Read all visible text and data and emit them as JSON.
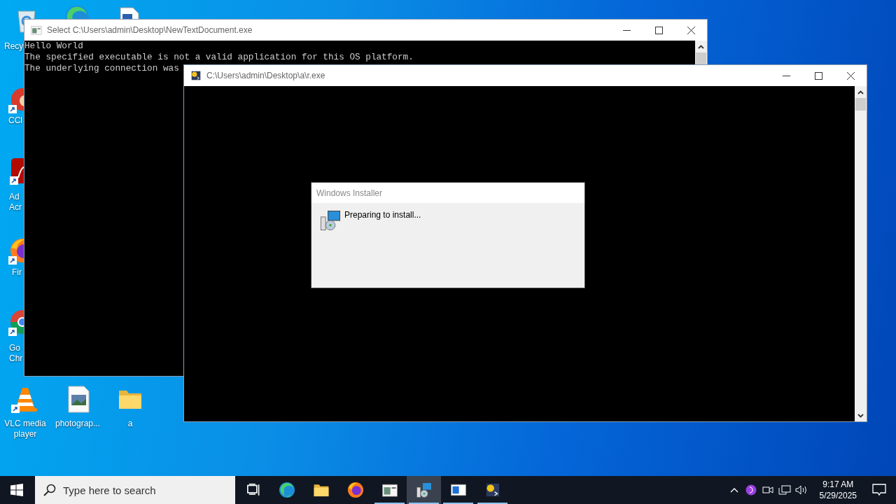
{
  "desktop_icons": [
    {
      "kind": "recycle-bin",
      "shortcut": false,
      "label": [
        "Recy"
      ]
    },
    {
      "kind": "browser",
      "shortcut": false
    },
    {
      "kind": "document",
      "shortcut": false
    },
    {
      "kind": "brush",
      "shortcut": true,
      "label": [
        "CCl"
      ]
    },
    {
      "kind": "pdf",
      "shortcut": true,
      "label": [
        "Ad",
        "Acr"
      ]
    },
    {
      "kind": "fox",
      "shortcut": true,
      "label": [
        "Fir"
      ]
    },
    {
      "kind": "chrome",
      "shortcut": true,
      "label": [
        "Go",
        "Chr"
      ]
    },
    {
      "kind": "cone",
      "shortcut": true,
      "label": [
        "VLC media",
        "player"
      ]
    },
    {
      "kind": "image-file",
      "shortcut": false,
      "label": [
        "photograp..."
      ]
    },
    {
      "kind": "folder",
      "shortcut": false,
      "label": [
        "a"
      ]
    }
  ],
  "windows": [
    {
      "title": "Select C:\\Users\\admin\\Desktop\\NewTextDocument.exe",
      "lines": [
        "Hello World",
        "The specified executable is not a valid application for this OS platform.",
        "The underlying connection was"
      ]
    },
    {
      "title": "C:\\Users\\admin\\Desktop\\a\\r.exe",
      "dialog": {
        "title": "Windows Installer",
        "message": "Preparing to install..."
      }
    }
  ],
  "taskbar": {
    "search": {
      "placeholder": "Type here to search"
    },
    "apps": [
      {
        "kind": "task-view",
        "running": false,
        "selected": false
      },
      {
        "kind": "browser",
        "running": false,
        "selected": false
      },
      {
        "kind": "folder",
        "running": false,
        "selected": false
      },
      {
        "kind": "fox",
        "running": false,
        "selected": false
      },
      {
        "kind": "console",
        "running": true,
        "selected": false
      },
      {
        "kind": "installer",
        "running": true,
        "selected": true
      },
      {
        "kind": "window",
        "running": true,
        "selected": false
      },
      {
        "kind": "python",
        "running": true,
        "selected": false
      }
    ],
    "clock": {
      "time": "9:17 AM",
      "date": "5/29/2025"
    }
  }
}
